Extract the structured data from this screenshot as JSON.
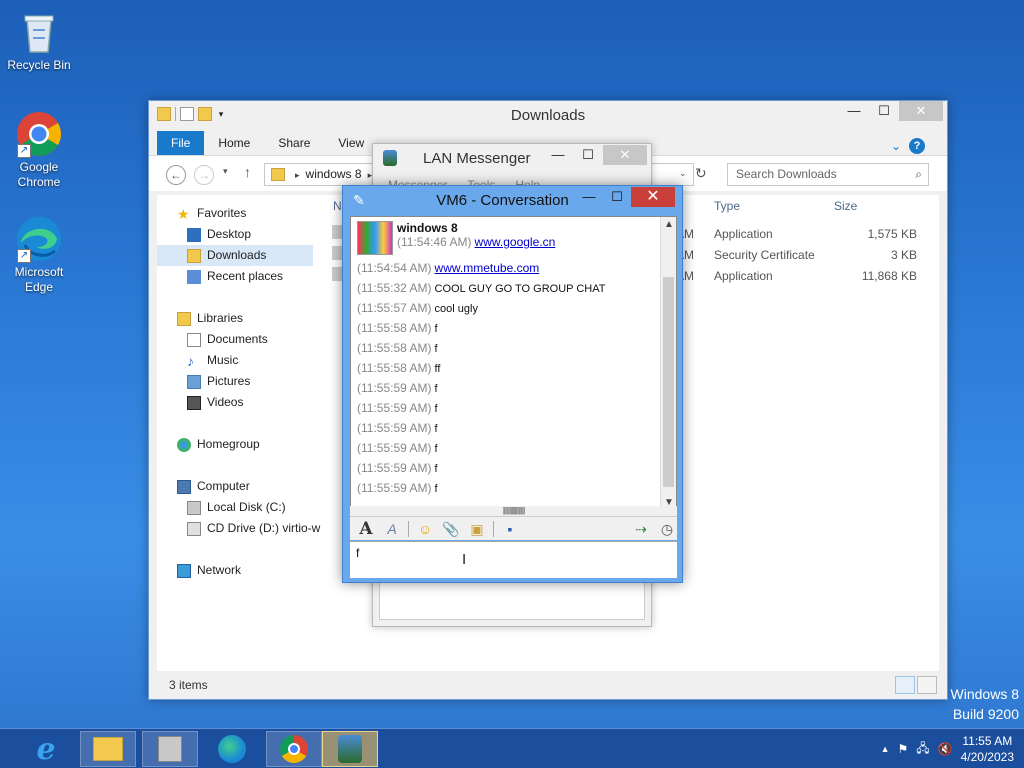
{
  "desktop": {
    "icons": [
      {
        "label": "Recycle Bin",
        "icon": "recycle-bin-icon"
      },
      {
        "label": "Google Chrome",
        "icon": "chrome-icon"
      },
      {
        "label": "Microsoft Edge",
        "icon": "edge-icon"
      }
    ],
    "watermark": {
      "line1": "Windows 8",
      "line2": "Build 9200"
    }
  },
  "explorer": {
    "title": "Downloads",
    "tabs": [
      "File",
      "Home",
      "Share",
      "View"
    ],
    "address_path": "windows 8",
    "search_placeholder": "Search Downloads",
    "nav": {
      "favorites": "Favorites",
      "desktop": "Desktop",
      "downloads": "Downloads",
      "recent": "Recent places",
      "libraries": "Libraries",
      "documents": "Documents",
      "music": "Music",
      "pictures": "Pictures",
      "videos": "Videos",
      "homegroup": "Homegroup",
      "computer": "Computer",
      "local_disk": "Local Disk (C:)",
      "cd_drive": "CD Drive (D:) virtio-w",
      "network": "Network"
    },
    "columns": {
      "name": "N",
      "type": "Type",
      "size": "Size"
    },
    "files": [
      {
        "time_suffix": "AM",
        "type": "Application",
        "size": "1,575 KB"
      },
      {
        "time_suffix": "AM",
        "type": "Security Certificate",
        "size": "3 KB"
      },
      {
        "time_suffix": "AM",
        "type": "Application",
        "size": "11,868 KB"
      }
    ],
    "status": "3 items"
  },
  "lan_messenger": {
    "title": "LAN Messenger",
    "menu": [
      "Messenger",
      "Tools",
      "Help"
    ]
  },
  "conversation": {
    "title": "VM6 - Conversation",
    "sender": "windows 8",
    "messages": [
      {
        "time": "(11:54:46 AM)",
        "text": "www.google.cn",
        "link": true
      },
      {
        "time": "(11:54:54 AM)",
        "text": "www.mmetube.com",
        "link": true
      },
      {
        "time": "(11:55:32 AM)",
        "text": "COOL GUY GO TO GROUP CHAT",
        "link": false
      },
      {
        "time": "(11:55:57 AM)",
        "text": "cool ugly",
        "link": false
      },
      {
        "time": "(11:55:58 AM)",
        "text": "f",
        "link": false
      },
      {
        "time": "(11:55:58 AM)",
        "text": "f",
        "link": false
      },
      {
        "time": "(11:55:58 AM)",
        "text": "ff",
        "link": false
      },
      {
        "time": "(11:55:59 AM)",
        "text": "f",
        "link": false
      },
      {
        "time": "(11:55:59 AM)",
        "text": "f",
        "link": false
      },
      {
        "time": "(11:55:59 AM)",
        "text": "f",
        "link": false
      },
      {
        "time": "(11:55:59 AM)",
        "text": "f",
        "link": false
      },
      {
        "time": "(11:55:59 AM)",
        "text": "f",
        "link": false
      },
      {
        "time": "(11:55:59 AM)",
        "text": "f",
        "link": false
      }
    ],
    "input_value": "f"
  },
  "taskbar": {
    "apps": [
      "internet-explorer-icon",
      "file-explorer-icon",
      "setup-icon",
      "edge-icon",
      "chrome-icon",
      "lan-messenger-icon"
    ],
    "clock_time": "11:55 AM",
    "clock_date": "4/20/2023"
  }
}
